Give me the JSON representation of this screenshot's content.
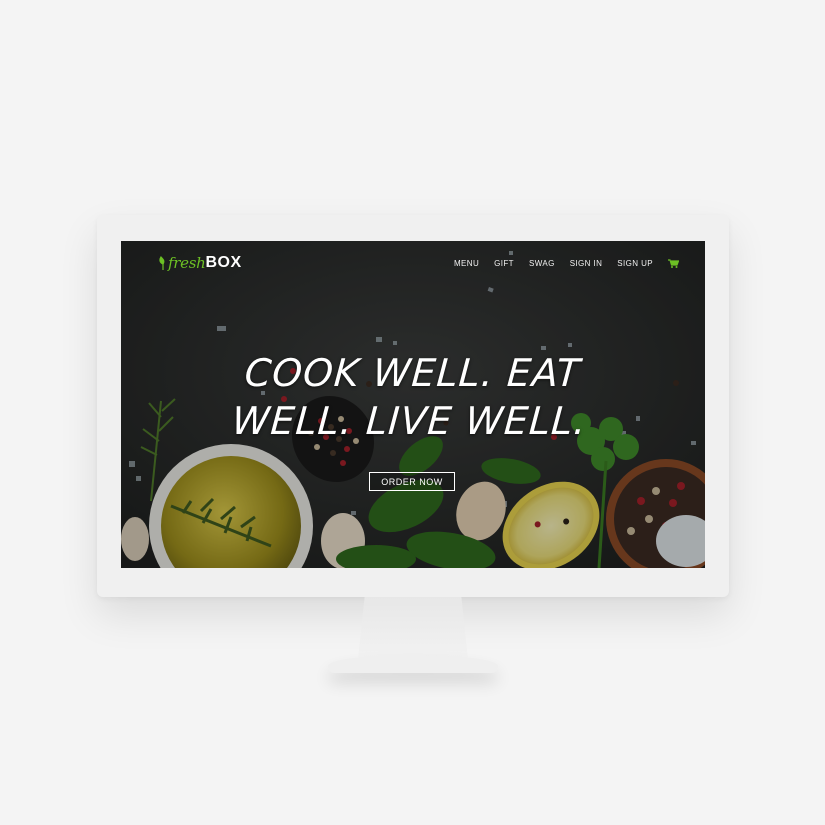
{
  "brand": {
    "part1": "fresh",
    "part2": "BOX",
    "accent_color": "#6cc024"
  },
  "nav": {
    "items": [
      {
        "label": "MENU"
      },
      {
        "label": "GIFT"
      },
      {
        "label": "SWAG"
      },
      {
        "label": "SIGN IN"
      },
      {
        "label": "SIGN UP"
      }
    ],
    "cart_icon": "shopping-cart-icon"
  },
  "hero": {
    "headline": "COOK WELL. EAT WELL. LIVE WELL.",
    "cta_label": "ORDER NOW",
    "background": "dark-slate-with-herbs-spices-olive-oil-lemon"
  }
}
